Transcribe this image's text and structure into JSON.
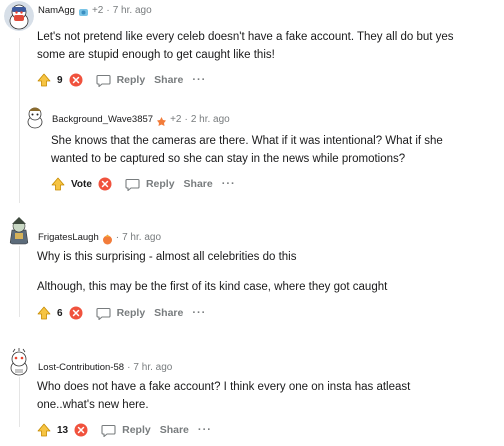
{
  "comments": [
    {
      "username": "NamAgg",
      "flair_count": "+2",
      "time": "7 hr. ago",
      "paragraphs": [
        "Let's not pretend like every celeb doesn't have a fake account. They all do but yes some are stupid enough to get caught like this!"
      ],
      "score": "9",
      "reply_label": "Reply",
      "share_label": "Share",
      "more_label": "···"
    },
    {
      "username": "Background_Wave3857",
      "flair_count": "+2",
      "time": "2 hr. ago",
      "paragraphs": [
        "She knows that the cameras are there. What if it was intentional? What if she wanted to be captured so she can stay in the news while promotions?"
      ],
      "score": "Vote",
      "reply_label": "Reply",
      "share_label": "Share",
      "more_label": "···"
    },
    {
      "username": "FrigatesLaugh",
      "time": "7 hr. ago",
      "paragraphs": [
        "Why is this surprising - almost all celebrities do this",
        "Although, this may be the first of its kind case, where they got caught"
      ],
      "score": "6",
      "reply_label": "Reply",
      "share_label": "Share",
      "more_label": "···"
    },
    {
      "username": "Lost-Contribution-58",
      "time": "7 hr. ago",
      "paragraphs": [
        "Who does not have a fake account? I think every one on insta has atleast one..what's new here."
      ],
      "score": "13",
      "reply_label": "Reply",
      "share_label": "Share",
      "more_label": "···"
    }
  ],
  "separator": "·",
  "colors": {
    "upvote": "#f0b400",
    "downvote": "#f0523d",
    "muted": "#787c7e",
    "text": "#1a1a1b",
    "thread_line": "#e5e5e5"
  }
}
